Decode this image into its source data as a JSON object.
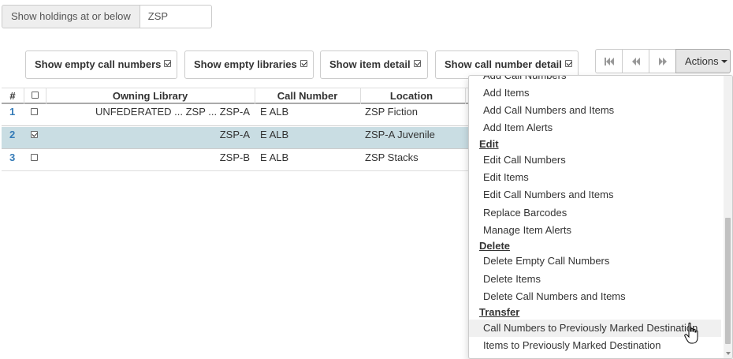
{
  "holdings": {
    "label": "Show holdings at or below",
    "value": "ZSP"
  },
  "toggles": [
    {
      "label": "Show empty call numbers",
      "checked": true
    },
    {
      "label": "Show empty libraries",
      "checked": true
    },
    {
      "label": "Show item detail",
      "checked": true
    },
    {
      "label": "Show call number detail",
      "checked": true
    }
  ],
  "pager": {
    "first_icon": "first-page-icon",
    "prev_icon": "prev-page-icon",
    "next_icon": "next-page-icon"
  },
  "actions": {
    "label": "Actions"
  },
  "grid": {
    "headers": {
      "num": "#",
      "owning_library": "Owning Library",
      "call_number": "Call Number",
      "location": "Location"
    },
    "rows": [
      {
        "num": "1",
        "owning_library": "UNFEDERATED ... ZSP ... ZSP-A",
        "call_number": "E ALB",
        "location": "ZSP Fiction",
        "selected": false
      },
      {
        "num": "2",
        "owning_library": "ZSP-A",
        "call_number": "E ALB",
        "location": "ZSP-A Juvenile",
        "selected": true
      },
      {
        "num": "3",
        "owning_library": "ZSP-B",
        "call_number": "E ALB",
        "location": "ZSP Stacks",
        "selected": false
      }
    ]
  },
  "menu": {
    "add_items": [
      "Add Call Numbers",
      "Add Items",
      "Add Call Numbers and Items",
      "Add Item Alerts"
    ],
    "edit_header": "Edit",
    "edit_items": [
      "Edit Call Numbers",
      "Edit Items",
      "Edit Call Numbers and Items",
      "Replace Barcodes",
      "Manage Item Alerts"
    ],
    "delete_header": "Delete",
    "delete_items": [
      "Delete Empty Call Numbers",
      "Delete Items",
      "Delete Call Numbers and Items"
    ],
    "transfer_header": "Transfer",
    "transfer_items": [
      "Call Numbers to Previously Marked Destination",
      "Items to Previously Marked Destination"
    ]
  },
  "colors": {
    "selected_row": "#c9dde3",
    "row_number": "#337ab7",
    "actions_bg": "#e6e6e6"
  }
}
